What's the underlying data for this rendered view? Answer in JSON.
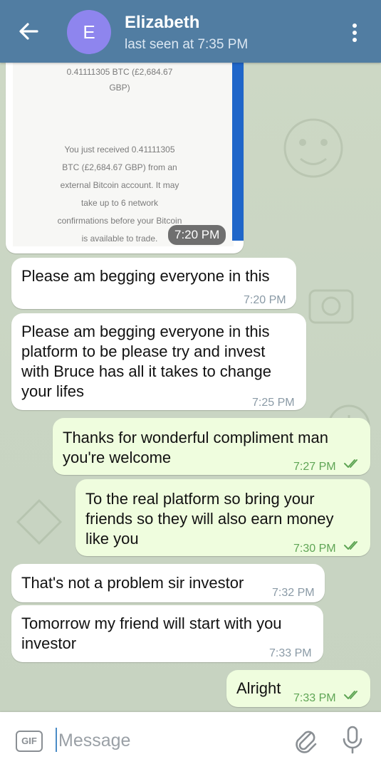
{
  "header": {
    "contact_name": "Elizabeth",
    "status": "last seen at 7:35 PM",
    "avatar_letter": "E",
    "avatar_color": "#8e85ee",
    "bar_color": "#517da2"
  },
  "image_message": {
    "amount_line_1": "0.41111305 BTC (£2,684.67",
    "amount_line_2": "GBP)",
    "body_lines": [
      "You just received 0.41111305",
      "BTC (£2,684.67 GBP) from an",
      "external Bitcoin account. It may",
      "take up to 6 network",
      "confirmations before your Bitcoin",
      "is available to trade."
    ],
    "time": "7:20 PM"
  },
  "messages": [
    {
      "direction": "in",
      "text": [
        "Please am begging everyone in this"
      ],
      "time": "7:20 PM"
    },
    {
      "direction": "in",
      "text": [
        "Please am begging everyone in this",
        "platform to be please try and invest",
        "with Bruce has all it takes to change",
        "your lifes"
      ],
      "time": "7:25 PM"
    },
    {
      "direction": "out",
      "text": [
        "Thanks for wonderful compliment man",
        "you're welcome"
      ],
      "time": "7:27 PM",
      "read": true
    },
    {
      "direction": "out",
      "text": [
        "To the real platform so bring your",
        "friends so they will also earn money",
        "like you"
      ],
      "time": "7:30 PM",
      "read": true
    },
    {
      "direction": "in",
      "text": [
        "That's not a problem sir investor"
      ],
      "time": "7:32 PM"
    },
    {
      "direction": "in",
      "text": [
        "Tomorrow my friend will start with you",
        "investor"
      ],
      "time": "7:33 PM"
    },
    {
      "direction": "out",
      "text": [
        "Alright"
      ],
      "time": "7:33 PM",
      "read": true
    }
  ],
  "input": {
    "gif_label": "GIF",
    "placeholder": "Message"
  },
  "icons": {
    "back": "arrow-left-icon",
    "menu": "more-vertical-icon",
    "attach": "paperclip-icon",
    "mic": "microphone-icon",
    "read": "double-check-icon"
  }
}
